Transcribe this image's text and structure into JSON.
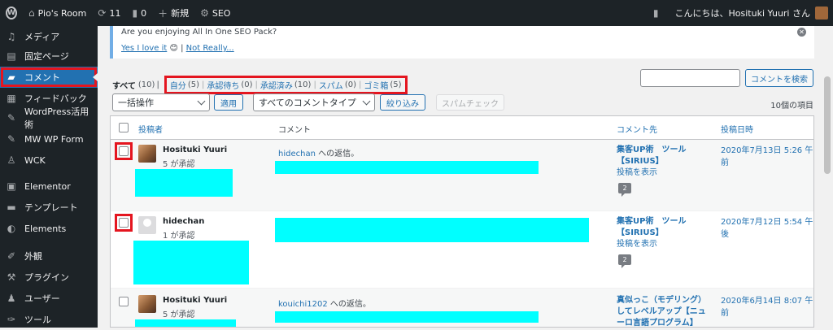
{
  "adminbar": {
    "site_name": "Pio's Room",
    "updates": "11",
    "comments": "0",
    "new_label": "新規",
    "seo_label": "SEO",
    "greeting": "こんにちは、Hosituki Yuuri さん"
  },
  "sidebar": {
    "items": [
      {
        "label": "メディア",
        "icon": "media-icon"
      },
      {
        "label": "固定ページ",
        "icon": "page-icon"
      },
      {
        "label": "コメント",
        "icon": "comment-icon"
      },
      {
        "label": "フィードバック",
        "icon": "feedback-icon"
      },
      {
        "label": "WordPress活用術",
        "icon": "pin-icon"
      },
      {
        "label": "MW WP Form",
        "icon": "pin-icon"
      },
      {
        "label": "WCK",
        "icon": "wck-icon"
      },
      {
        "label": "Elementor",
        "icon": "elementor-icon"
      },
      {
        "label": "テンプレート",
        "icon": "folder-icon"
      },
      {
        "label": "Elements",
        "icon": "elements-icon"
      },
      {
        "label": "外観",
        "icon": "appearance-icon"
      },
      {
        "label": "プラグイン",
        "icon": "plugin-icon"
      },
      {
        "label": "ユーザー",
        "icon": "user-icon"
      },
      {
        "label": "ツール",
        "icon": "tool-icon"
      }
    ],
    "active_index": 2
  },
  "notice": {
    "message": "Are you enjoying All In One SEO Pack?",
    "love_link": "Yes I love it",
    "smile": "😊",
    "separator": "|",
    "not_really": "Not Really..."
  },
  "filters": {
    "all_label": "すべて",
    "all_count": "(10)",
    "sep": "|",
    "mine_label": "自分",
    "mine_count": "(5)",
    "pending_label": "承認待ち",
    "pending_count": "(0)",
    "approved_label": "承認済み",
    "approved_count": "(10)",
    "spam_label": "スパム",
    "spam_count": "(0)",
    "trash_label": "ゴミ箱",
    "trash_count": "(5)"
  },
  "search": {
    "value": "",
    "button": "コメントを検索"
  },
  "toolbar": {
    "bulk_action": "一括操作",
    "apply": "適用",
    "comment_type": "すべてのコメントタイプ",
    "filter": "絞り込み",
    "spam_check": "スパムチェック",
    "items_count": "10個の項目"
  },
  "table": {
    "headers": {
      "author": "投稿者",
      "comment": "コメント",
      "response": "コメント先",
      "date": "投稿日時"
    },
    "rows": [
      {
        "author": "Hosituki Yuuri",
        "approved": "5 が承認",
        "reply_to": "hidechan",
        "reply_suffix": " への返信。",
        "response_title": "集客UP術　ツール【SIRIUS】",
        "view_post": "投稿を表示",
        "bubble": "2",
        "date": "2020年7月13日 5:26 午前"
      },
      {
        "author": "hidechan",
        "approved": "1 が承認",
        "reply_to": "",
        "reply_suffix": "",
        "response_title": "集客UP術　ツール【SIRIUS】",
        "view_post": "投稿を表示",
        "bubble": "2",
        "date": "2020年7月12日 5:54 午後"
      },
      {
        "author": "Hosituki Yuuri",
        "approved": "5 が承認",
        "reply_to": "kouichi1202",
        "reply_suffix": " への返信。",
        "response_title": "真似っこ（モデリング）してレベルアップ【ニューロ言語プログラム】",
        "view_post": "",
        "bubble": "",
        "date": "2020年6月14日 8:07 午前"
      }
    ]
  },
  "colors": {
    "admin_bg": "#1d2327",
    "accent": "#2271b1",
    "highlight_red": "#e4151f",
    "redaction": "#00ffff"
  }
}
